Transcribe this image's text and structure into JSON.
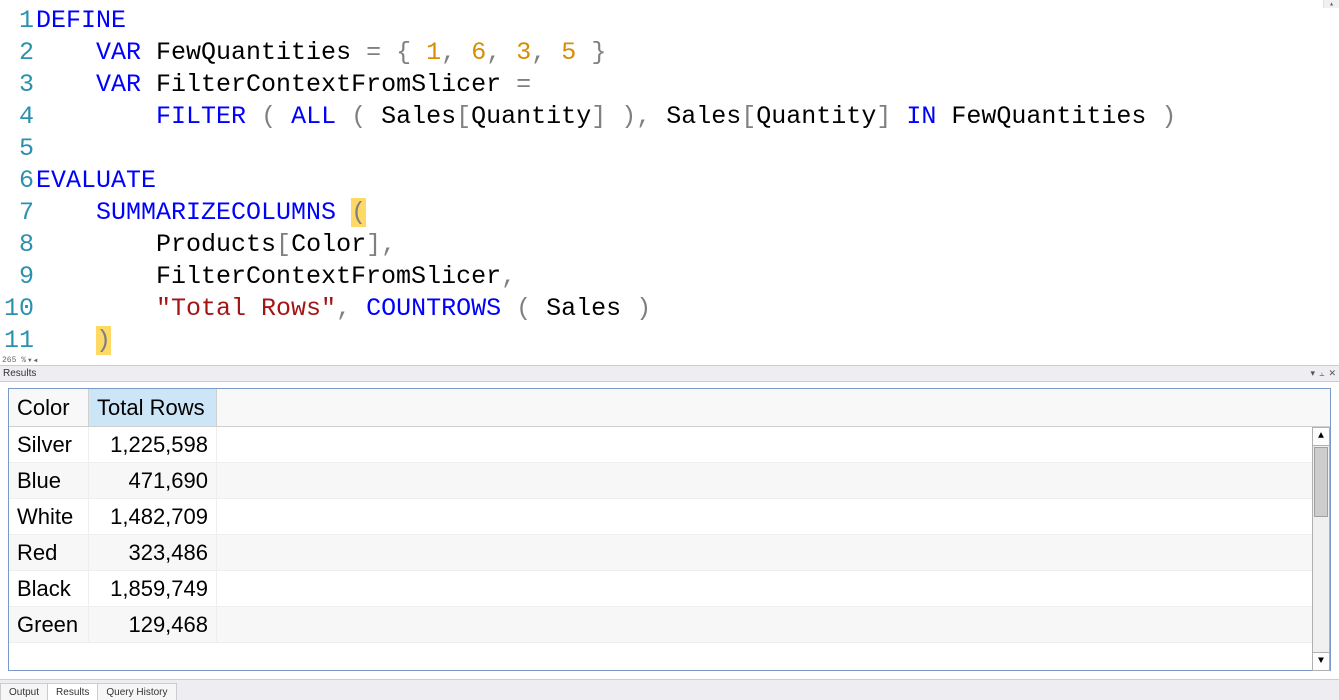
{
  "editor": {
    "zoom_label": "265 %",
    "lines": [
      1,
      2,
      3,
      4,
      5,
      6,
      7,
      8,
      9,
      10,
      11
    ],
    "code": {
      "l1_define": "DEFINE",
      "l2_var": "VAR",
      "l2_name": "FewQuantities",
      "l2_eq": "=",
      "l2_open": "{",
      "l2_n1": "1",
      "l2_c1": ",",
      "l2_n2": "6",
      "l2_c2": ",",
      "l2_n3": "3",
      "l2_c3": ",",
      "l2_n4": "5",
      "l2_close": "}",
      "l3_var": "VAR",
      "l3_name": "FilterContextFromSlicer",
      "l3_eq": "=",
      "l4_filter": "FILTER",
      "l4_op1": "(",
      "l4_all": "ALL",
      "l4_op2": "(",
      "l4_tbl1a": "Sales",
      "l4_br1": "[",
      "l4_col1": "Quantity",
      "l4_br2": "]",
      "l4_cp1": ")",
      "l4_comma": ",",
      "l4_tbl1b": "Sales",
      "l4_br3": "[",
      "l4_col2": "Quantity",
      "l4_br4": "]",
      "l4_in": "IN",
      "l4_ref": "FewQuantities",
      "l4_cp2": ")",
      "l6_eval": "EVALUATE",
      "l7_summ": "SUMMARIZECOLUMNS",
      "l7_op": "(",
      "l8_tbl": "Products",
      "l8_br1": "[",
      "l8_col": "Color",
      "l8_br2": "]",
      "l8_comma": ",",
      "l9_ref": "FilterContextFromSlicer",
      "l9_comma": ",",
      "l10_str": "\"Total Rows\"",
      "l10_comma": ",",
      "l10_fn": "COUNTROWS",
      "l10_op": "(",
      "l10_tbl": "Sales",
      "l10_cp": ")",
      "l11_cp": ")"
    }
  },
  "results_panel": {
    "title": "Results",
    "columns": [
      "Color",
      "Total Rows"
    ],
    "selected_col": 1,
    "rows": [
      {
        "color": "Silver",
        "total": "1,225,598"
      },
      {
        "color": "Blue",
        "total": "471,690"
      },
      {
        "color": "White",
        "total": "1,482,709"
      },
      {
        "color": "Red",
        "total": "323,486"
      },
      {
        "color": "Black",
        "total": "1,859,749"
      },
      {
        "color": "Green",
        "total": "129,468"
      }
    ]
  },
  "status_tabs": {
    "items": [
      "Output",
      "Results",
      "Query History"
    ],
    "active": 1
  }
}
